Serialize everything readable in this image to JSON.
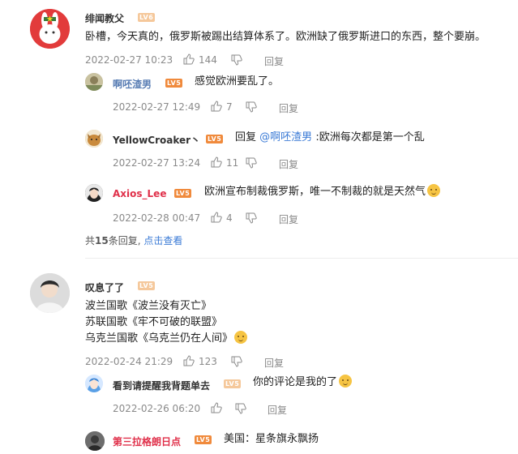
{
  "comments": [
    {
      "user": "绯闻教父",
      "level": "LV6",
      "text": "卧槽，今天真的，俄罗斯被踢出结算体系了。欧洲缺了俄罗斯进口的东西，整个要崩。",
      "time": "2022-02-27 10:23",
      "likes": "144",
      "reply_label": "回复",
      "replies": [
        {
          "user": "啊呸渣男",
          "level": "LV5",
          "text": "感觉欧洲要乱了。",
          "time": "2022-02-27 12:49",
          "likes": "7",
          "reply_label": "回复"
        },
        {
          "user": "YellowCroaker丶",
          "level": "LV5",
          "reply_prefix": "回复",
          "mention": "@啊呸渣男",
          "text": ":欧洲每次都是第一个乱",
          "time": "2022-02-27 13:24",
          "likes": "11",
          "reply_label": "回复"
        },
        {
          "user": "Axios_Lee",
          "level": "LV5",
          "text": "欧洲宣布制裁俄罗斯，唯一不制裁的就是天然气",
          "time": "2022-02-28 00:47",
          "likes": "4",
          "reply_label": "回复"
        }
      ],
      "summary_prefix": "共",
      "summary_count": "15",
      "summary_suffix": "条回复,",
      "summary_link": "点击查看"
    },
    {
      "user": "叹息了了",
      "level": "LV5",
      "lines": [
        "波兰国歌《波兰没有灭亡》",
        "苏联国歌《牢不可破的联盟》",
        "乌克兰国歌《乌克兰仍在人间》"
      ],
      "time": "2022-02-24 21:29",
      "likes": "123",
      "reply_label": "回复",
      "replies": [
        {
          "user": "看到请提醒我背题单去",
          "level": "LV5",
          "text": "你的评论是我的了",
          "time": "2022-02-26 06:20",
          "reply_label": "回复"
        },
        {
          "user": "第三拉格朗日点",
          "level": "LV5",
          "text": "美国：星条旗永飘扬"
        }
      ]
    }
  ],
  "icons": {
    "like": "thumbs-up-icon",
    "dislike": "thumbs-down-icon",
    "emoji": "smile-emoji-icon"
  }
}
